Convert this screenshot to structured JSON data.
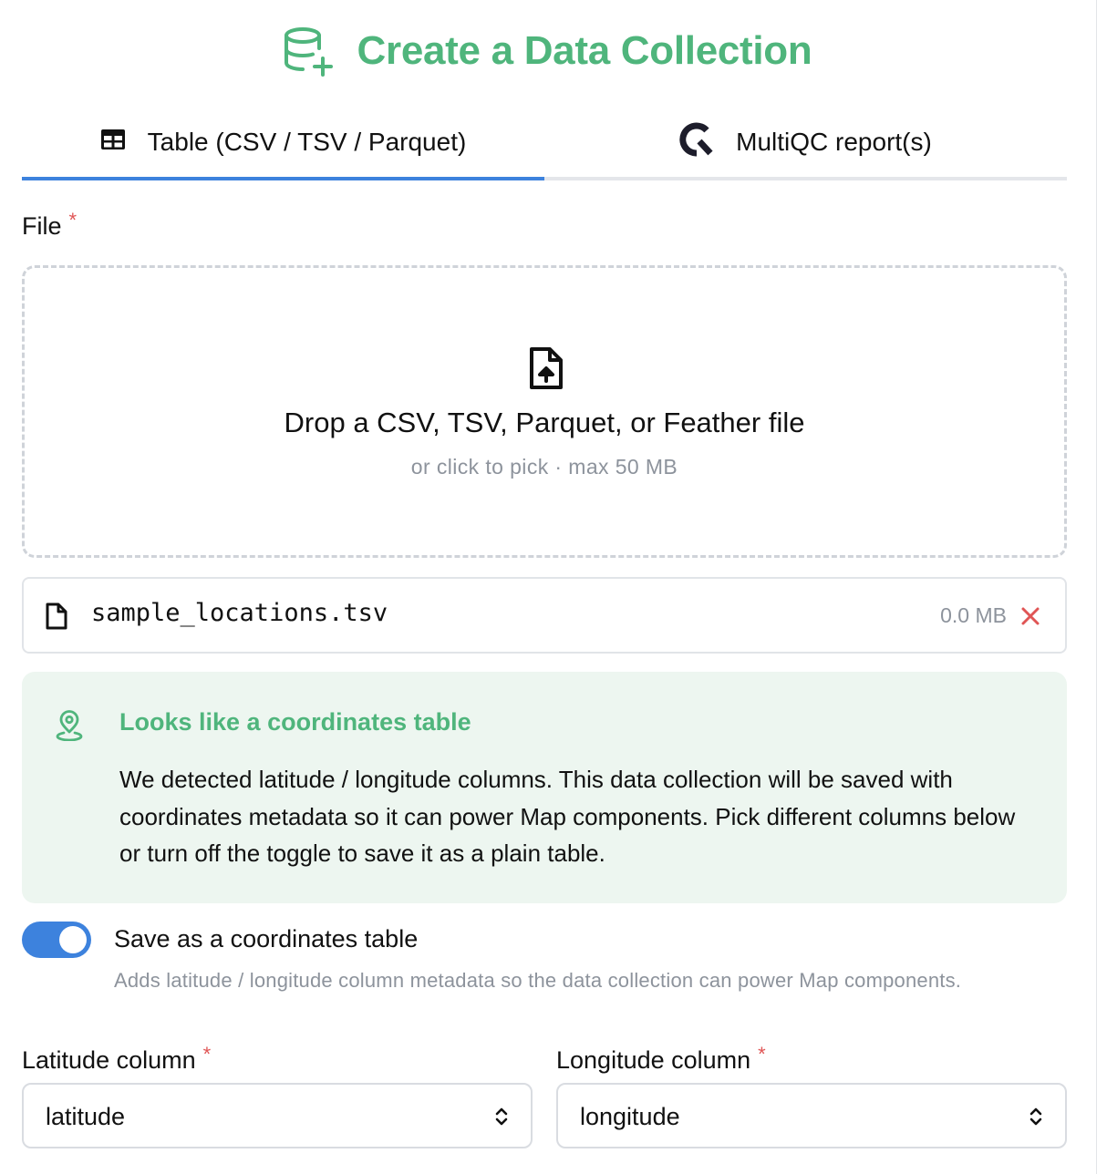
{
  "header": {
    "title": "Create a Data Collection",
    "icon": "database-plus-icon"
  },
  "tabs": [
    {
      "label": "Table (CSV / TSV / Parquet)",
      "icon": "table-icon",
      "active": true
    },
    {
      "label": "MultiQC report(s)",
      "icon": "multiqc-logo-icon",
      "active": false
    }
  ],
  "file_field": {
    "label": "File",
    "required_mark": "*"
  },
  "dropzone": {
    "title": "Drop a CSV, TSV, Parquet, or Feather file",
    "subtitle": "or click to pick · max 50 MB",
    "icon": "file-upload-icon"
  },
  "selected_file": {
    "name": "sample_locations.tsv",
    "size": "0.0 MB",
    "remove_icon": "close-icon"
  },
  "alert": {
    "title": "Looks like a coordinates table",
    "body": "We detected latitude / longitude columns. This data collection will be saved with coordinates metadata so it can power Map components. Pick different columns below or turn off the toggle to save it as a plain table.",
    "icon": "map-pin-icon"
  },
  "toggle": {
    "label": "Save as a coordinates table",
    "description": "Adds latitude / longitude column metadata so the data collection can power Map components.",
    "checked": true
  },
  "latitude": {
    "label": "Latitude column",
    "required_mark": "*",
    "value": "latitude"
  },
  "longitude": {
    "label": "Longitude column",
    "required_mark": "*",
    "value": "longitude"
  },
  "colors": {
    "accent_green": "#4fb57c",
    "accent_blue": "#3d82dd",
    "required_red": "#e05555",
    "alert_bg": "#edf6f0"
  }
}
